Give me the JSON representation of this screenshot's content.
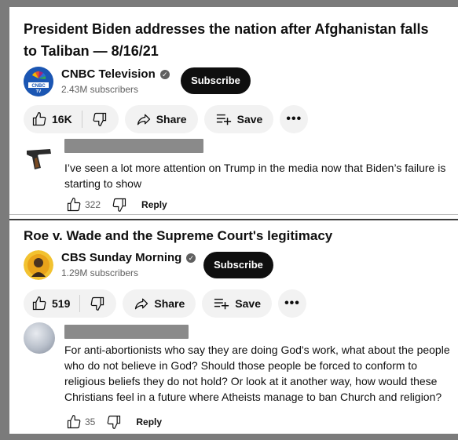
{
  "post1": {
    "title": "President Biden addresses the nation after Afghanistan falls to Taliban — 8/16/21",
    "channel": {
      "name": "CNBC Television",
      "subscribers": "2.43M subscribers",
      "avatar_text": "CNBC TV",
      "verified_icon": "check-icon"
    },
    "subscribe_label": "Subscribe",
    "actions": {
      "likes": "16K",
      "share_label": "Share",
      "save_label": "Save",
      "more_label": "•••"
    },
    "comment": {
      "text": "I’ve seen a lot more attention on Trump in the media now that Biden’s failure is starting to show",
      "likes": "322",
      "reply_label": "Reply"
    }
  },
  "post2": {
    "title": "Roe v. Wade and the Supreme Court's legitimacy",
    "channel": {
      "name": "CBS Sunday Morning",
      "subscribers": "1.29M subscribers",
      "verified_icon": "check-icon"
    },
    "subscribe_label": "Subscribe",
    "actions": {
      "likes": "519",
      "share_label": "Share",
      "save_label": "Save",
      "more_label": "•••"
    },
    "comment": {
      "text": "For anti-abortionists who say they are doing God's work, what about the people who do not believe in God?  Should those people be forced to conform to religious beliefs they do not hold?  Or look at it another way, how would these Christians feel in a future where Atheists manage to ban Church and religion?",
      "likes": "35",
      "reply_label": "Reply"
    }
  },
  "colors": {
    "subscribe_bg": "#0f0f0f",
    "pill_bg": "#f2f2f2",
    "redaction": "#8a8a8a",
    "frame": "#7b7b7b"
  }
}
